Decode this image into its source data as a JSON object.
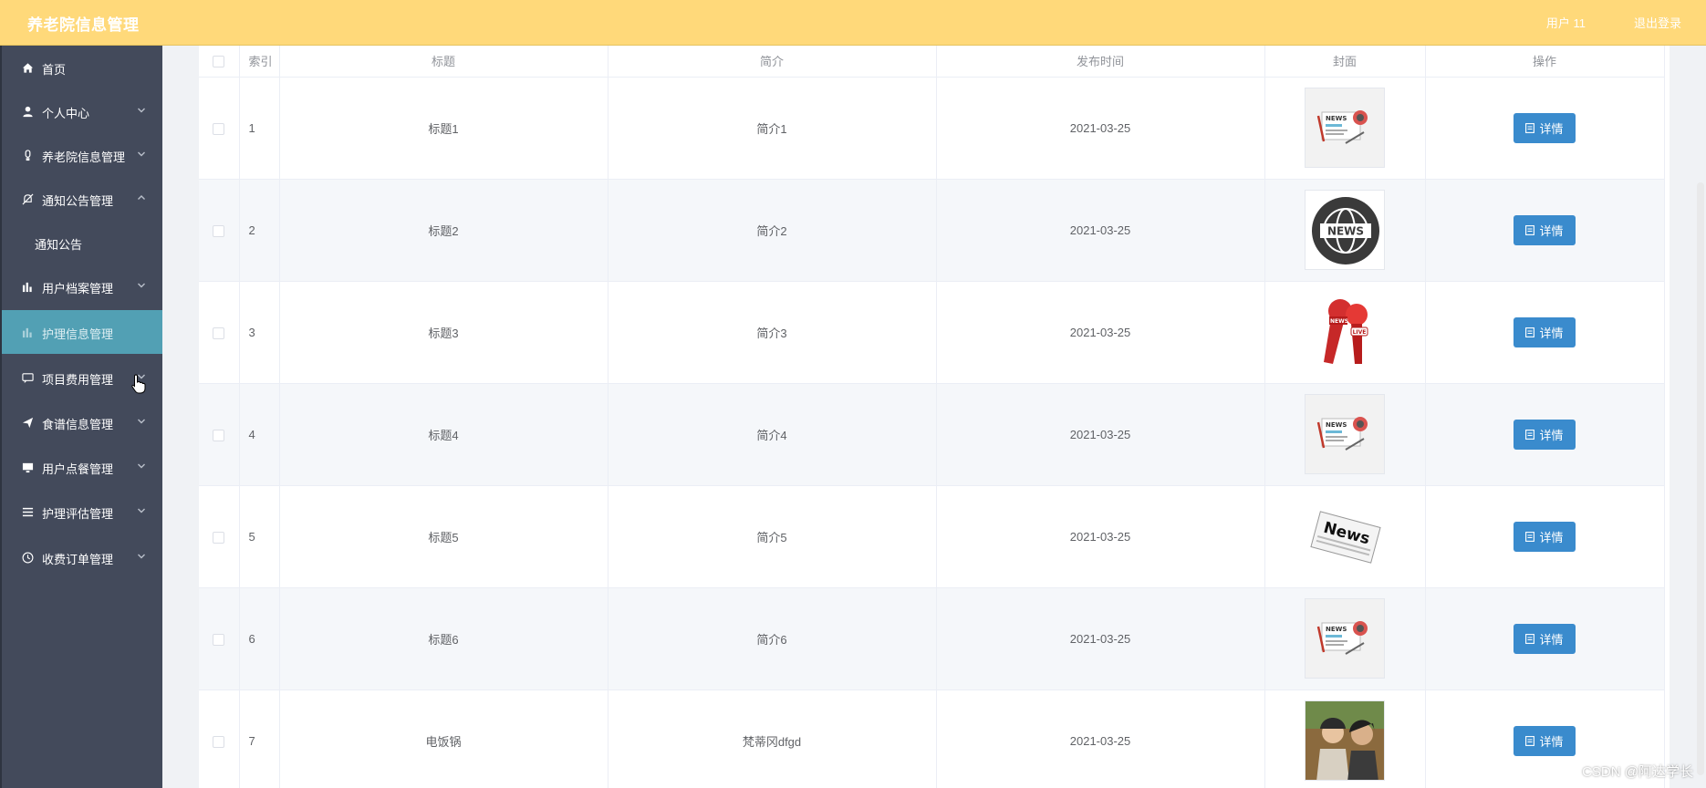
{
  "header": {
    "title": "养老院信息管理",
    "user": "用户 11",
    "logout": "退出登录"
  },
  "sidebar": {
    "items": [
      {
        "label": "首页",
        "icon": "home-icon",
        "arrow": ""
      },
      {
        "label": "个人中心",
        "icon": "user-icon",
        "arrow": "down"
      },
      {
        "label": "养老院信息管理",
        "icon": "bulb-icon",
        "arrow": "down"
      },
      {
        "label": "通知公告管理",
        "icon": "bell-off-icon",
        "arrow": "up"
      },
      {
        "label": "通知公告",
        "icon": "",
        "arrow": ""
      },
      {
        "label": "用户档案管理",
        "icon": "chart-icon",
        "arrow": "down"
      },
      {
        "label": "护理信息管理",
        "icon": "chart-icon",
        "arrow": ""
      },
      {
        "label": "项目费用管理",
        "icon": "chat-icon",
        "arrow": "down"
      },
      {
        "label": "食谱信息管理",
        "icon": "send-icon",
        "arrow": "down"
      },
      {
        "label": "用户点餐管理",
        "icon": "monitor-icon",
        "arrow": "down"
      },
      {
        "label": "护理评估管理",
        "icon": "menu-icon",
        "arrow": "down"
      },
      {
        "label": "收费订单管理",
        "icon": "clock-icon",
        "arrow": "down"
      }
    ],
    "active_index": 6
  },
  "table": {
    "columns": [
      "索引",
      "标题",
      "简介",
      "发布时间",
      "封面",
      "操作"
    ],
    "detail_label": "详情",
    "rows": [
      {
        "index": "1",
        "title": "标题1",
        "intro": "简介1",
        "date": "2021-03-25",
        "cover": "newspaper"
      },
      {
        "index": "2",
        "title": "标题2",
        "intro": "简介2",
        "date": "2021-03-25",
        "cover": "news-globe"
      },
      {
        "index": "3",
        "title": "标题3",
        "intro": "简介3",
        "date": "2021-03-25",
        "cover": "live-mics"
      },
      {
        "index": "4",
        "title": "标题4",
        "intro": "简介4",
        "date": "2021-03-25",
        "cover": "newspaper"
      },
      {
        "index": "5",
        "title": "标题5",
        "intro": "简介5",
        "date": "2021-03-25",
        "cover": "news-paper-bw"
      },
      {
        "index": "6",
        "title": "标题6",
        "intro": "简介6",
        "date": "2021-03-25",
        "cover": "newspaper"
      },
      {
        "index": "7",
        "title": "电饭锅",
        "intro": "梵蒂冈dfgd",
        "date": "2021-03-25",
        "cover": "photo"
      }
    ]
  },
  "cover_text": {
    "news": "NEWS",
    "live": "LIVE",
    "news_script": "News"
  },
  "watermark": "CSDN @阿达学长",
  "colors": {
    "header": "#ffd97a",
    "sidebar": "#434a5b",
    "active": "#52a0b4",
    "button": "#3a8bcd"
  }
}
